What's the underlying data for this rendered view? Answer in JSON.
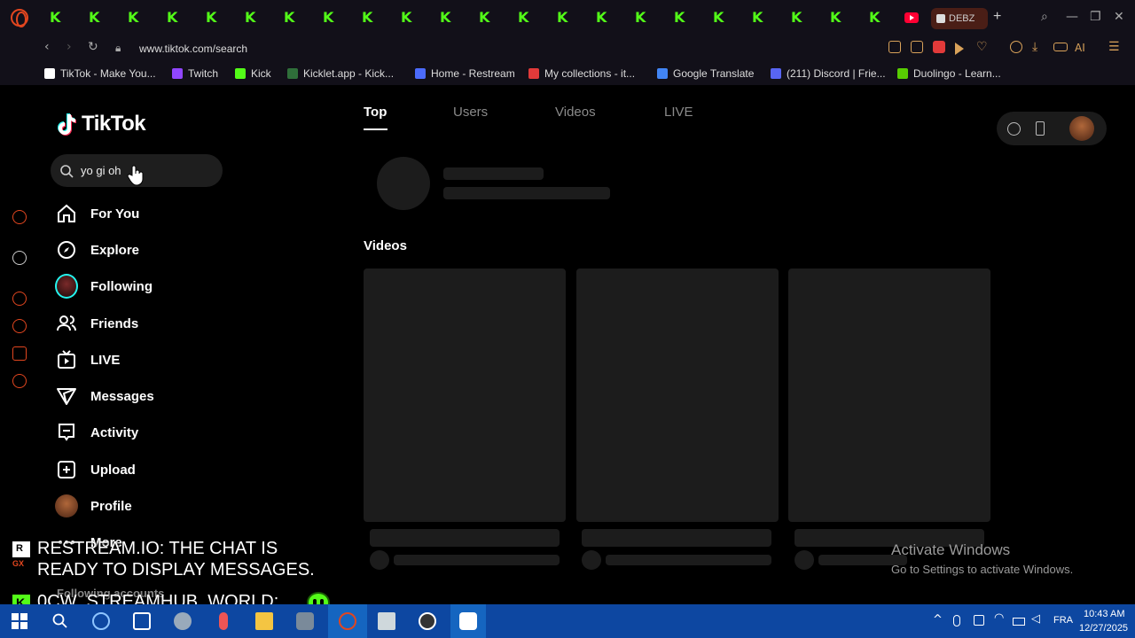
{
  "browser": {
    "active_tab_label": "DEBZ",
    "new_tab_label": "+",
    "url": "www.tiktok.com/search",
    "ai_label": "AI"
  },
  "bookmarks": [
    {
      "label": "TikTok - Make You...",
      "color": "#ffffff"
    },
    {
      "label": "Twitch",
      "color": "#9146ff"
    },
    {
      "label": "Kick",
      "color": "#53fc18"
    },
    {
      "label": "Kicklet.app - Kick...",
      "color": "#2f6f3a"
    },
    {
      "label": "Home - Restream",
      "color": "#4b6bfb"
    },
    {
      "label": "My collections - it...",
      "color": "#e23a3a"
    },
    {
      "label": "Google Translate",
      "color": "#4285f4"
    },
    {
      "label": "(211) Discord | Frie...",
      "color": "#5865f2"
    },
    {
      "label": "Duolingo - Learn...",
      "color": "#58cc02"
    }
  ],
  "tiktok": {
    "logo_text": "TikTok",
    "search_value": "yo gi oh",
    "nav": [
      {
        "label": "For You",
        "icon": "home-icon"
      },
      {
        "label": "Explore",
        "icon": "compass-icon"
      },
      {
        "label": "Following",
        "icon": "following-avatar-icon"
      },
      {
        "label": "Friends",
        "icon": "friends-icon"
      },
      {
        "label": "LIVE",
        "icon": "live-tv-icon"
      },
      {
        "label": "Messages",
        "icon": "send-icon"
      },
      {
        "label": "Activity",
        "icon": "activity-icon"
      },
      {
        "label": "Upload",
        "icon": "plus-square-icon"
      },
      {
        "label": "Profile",
        "icon": "profile-avatar-icon"
      },
      {
        "label": "More",
        "icon": "more-icon"
      }
    ],
    "following_accounts_label": "Following accounts",
    "tabs": [
      "Top",
      "Users",
      "Videos",
      "LIVE"
    ],
    "videos_heading": "Videos"
  },
  "overlay": {
    "chat_line_1a": "RESTREAM.IO: THE CHAT IS",
    "chat_line_1b": "READY TO DISPLAY MESSAGES.",
    "chat_line_2": "0CW_STREAMHUB_WORLD:",
    "activate_title": "Activate Windows",
    "activate_sub": "Go to Settings to activate Windows."
  },
  "taskbar": {
    "language": "FRA",
    "time": "10:43 AM",
    "date": "12/27/2025"
  },
  "colors": {
    "kick_green": "#53fc18",
    "opera_red": "#e2461f",
    "taskbar_blue": "#0d47a1"
  }
}
